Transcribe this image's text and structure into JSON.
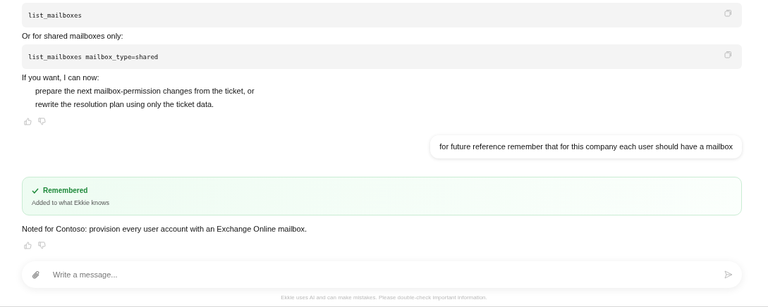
{
  "messages": [
    {
      "kind": "code",
      "code": "list_mailboxes"
    },
    {
      "kind": "text",
      "text": "Or for shared mailboxes only:"
    },
    {
      "kind": "code",
      "code": "list_mailboxes mailbox_type=shared"
    },
    {
      "kind": "text",
      "text": "If you want, I can now:"
    },
    {
      "kind": "list",
      "items": [
        "prepare the next mailbox-permission changes from the ticket, or",
        "rewrite the resolution plan using only the ticket data."
      ]
    },
    {
      "kind": "feedback"
    },
    {
      "kind": "user",
      "text": "for future reference remember that for this company each user should have a mailbox"
    },
    {
      "kind": "memory",
      "title": "Remembered",
      "subtitle": "Added to what Ekkie knows"
    },
    {
      "kind": "text",
      "text": "Noted for Contoso: provision every user account with an Exchange Online mailbox."
    },
    {
      "kind": "feedback"
    }
  ],
  "composer": {
    "placeholder": "Write a message..."
  },
  "disclaimer": "Ekkie uses AI and can make mistakes. Please double-check important information."
}
